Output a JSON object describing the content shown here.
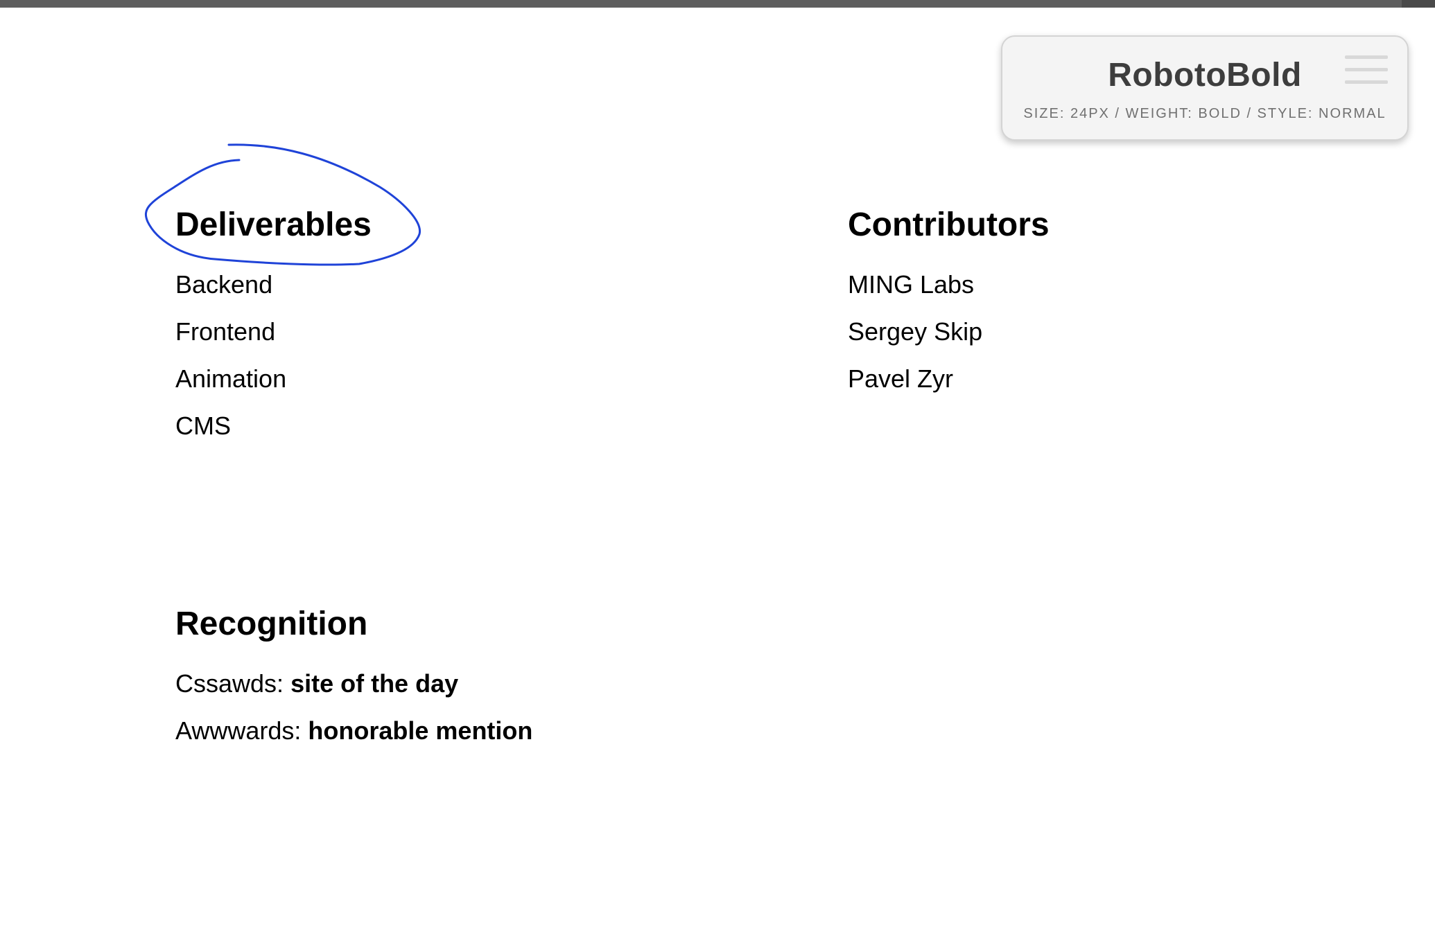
{
  "font_inspector": {
    "font_name": "RobotoBold",
    "spec": "SIZE: 24PX / WEIGHT: BOLD / STYLE: NORMAL",
    "menu_icon": "hamburger-menu-icon"
  },
  "deliverables": {
    "title": "Deliverables",
    "items": [
      "Backend",
      "Frontend",
      "Animation",
      "CMS"
    ]
  },
  "contributors": {
    "title": "Contributors",
    "items": [
      "MING Labs",
      "Sergey Skip",
      "Pavel Zyr"
    ]
  },
  "recognition": {
    "title": "Recognition",
    "items": [
      {
        "source": "Cssawds:",
        "award": "site of the day"
      },
      {
        "source": "Awwwards:",
        "award": "honorable mention"
      }
    ]
  },
  "colors": {
    "annotation_stroke": "#1f43d8",
    "top_bar": "#5e5e5e",
    "popup_background": "#f4f4f4"
  }
}
